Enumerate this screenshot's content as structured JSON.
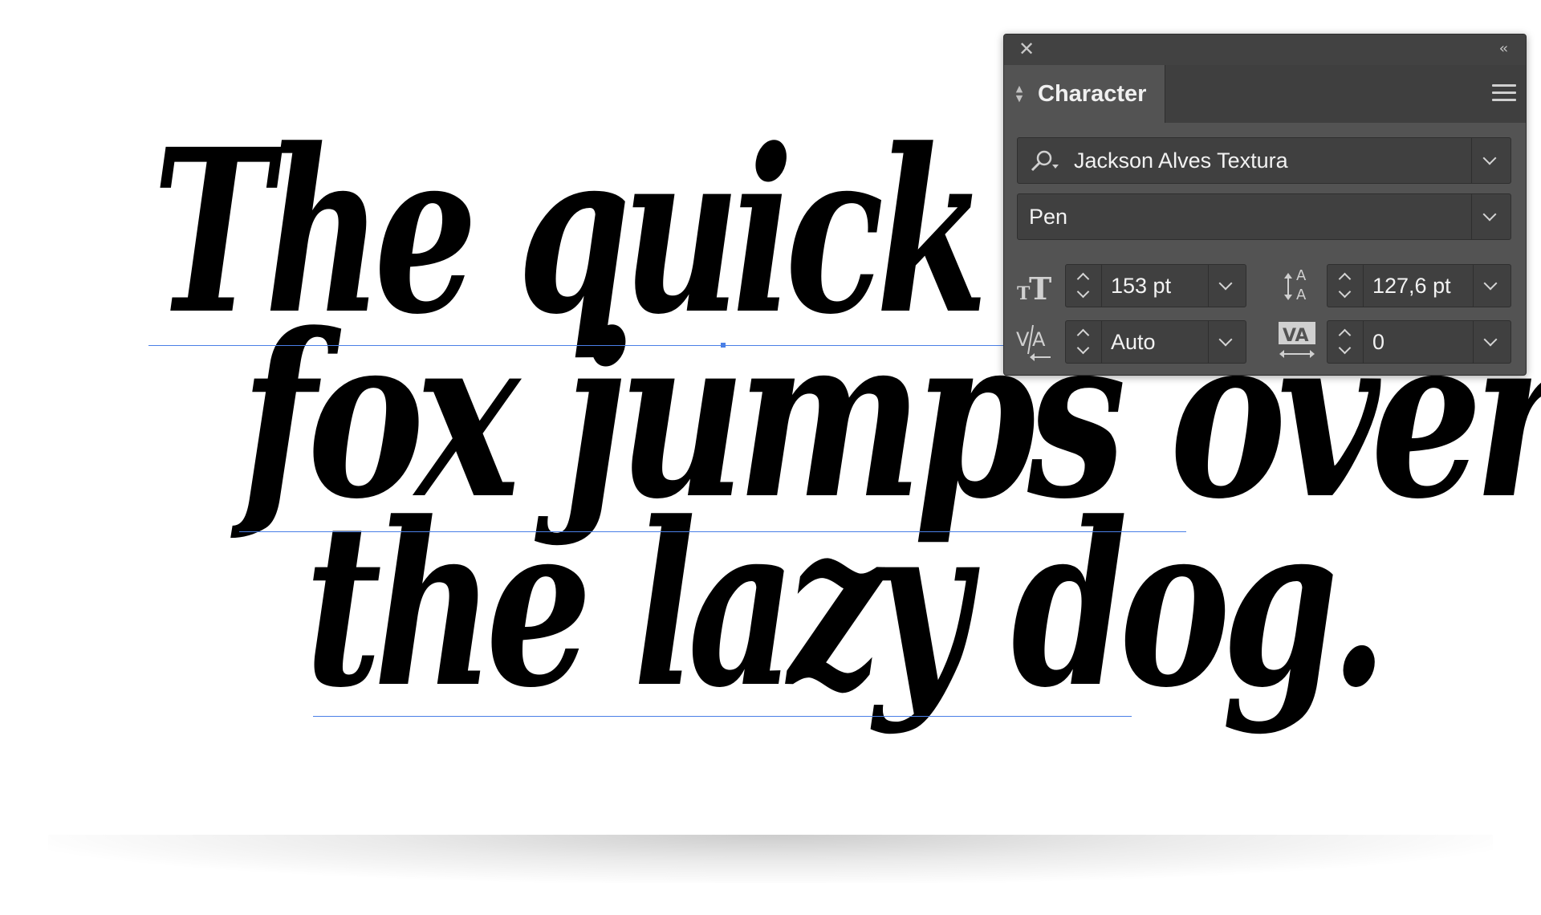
{
  "specimen": {
    "lines": [
      "The quick br",
      "fox jumps over",
      "the lazy dog."
    ]
  },
  "panel": {
    "tab_label": "Character",
    "icons": {
      "close": "close-icon",
      "collapse": "double-chevron-left-icon",
      "menu": "hamburger-menu-icon",
      "font_search": "search-icon",
      "font_size": "font-size-icon",
      "leading": "leading-icon",
      "kerning": "kerning-icon",
      "tracking": "tracking-icon"
    },
    "font_family": "Jackson Alves Textura",
    "font_style": "Pen",
    "font_size": "153 pt",
    "leading": "127,6 pt",
    "kerning": "Auto",
    "tracking": "0"
  },
  "colors": {
    "panel_bg": "#535353",
    "field_bg": "#404040",
    "baseline_guide": "#4a7fe6"
  }
}
